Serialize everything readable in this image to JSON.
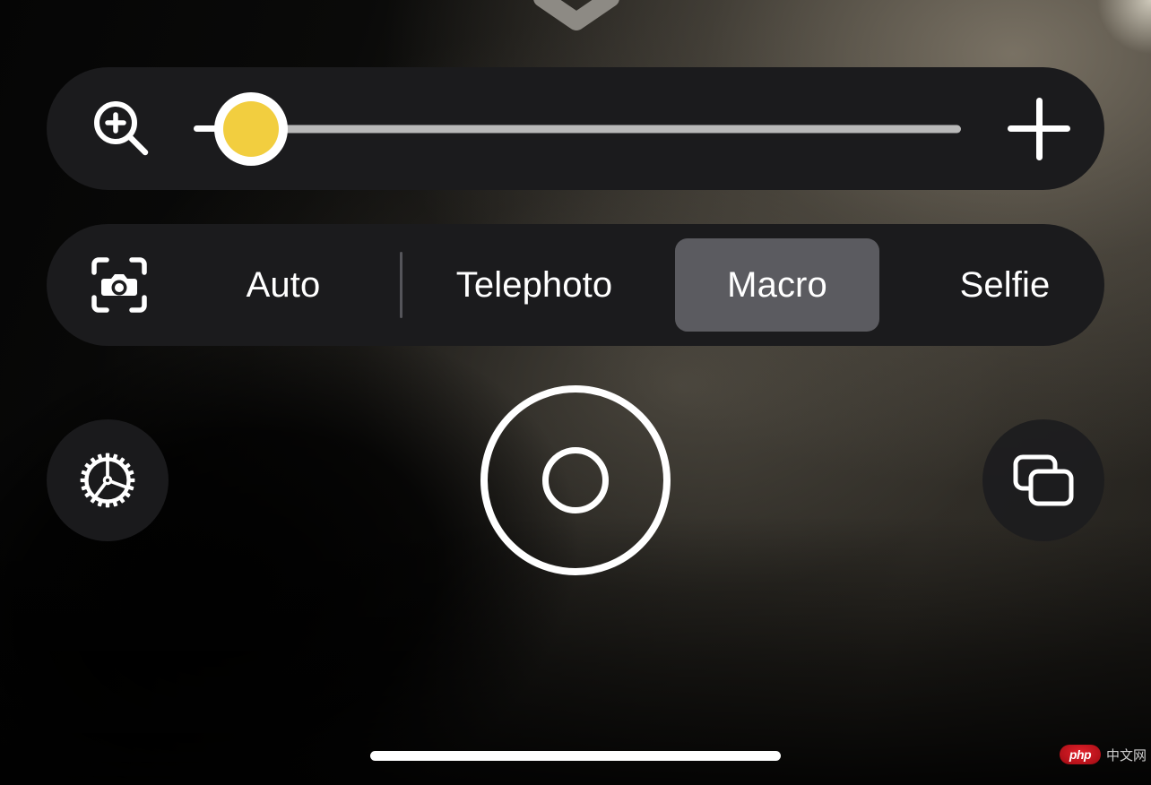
{
  "app": {
    "name": "Camera",
    "screen": "camera-viewfinder"
  },
  "handle": {
    "icon": "chevron-down-icon",
    "label": "Collapse controls"
  },
  "zoom_bar": {
    "icon": "magnifier-plus-icon",
    "zoom_out_label": "−",
    "zoom_out_name": "zoom-out-button",
    "zoom_in_label": "+",
    "zoom_in_name": "zoom-in-button",
    "slider": {
      "name": "zoom-slider",
      "value": 0,
      "min": 0,
      "max": 100,
      "thumb_color": "#f2ce3f",
      "thumb_ring_color": "#ffffff",
      "track_color": "#b9b9b9"
    }
  },
  "mode_bar": {
    "icon": "camera-frame-icon",
    "selected": "Macro",
    "items": [
      {
        "label": "Auto",
        "name": "mode-item-auto",
        "selected": false
      },
      {
        "label": "Telephoto",
        "name": "mode-item-telephoto",
        "selected": false
      },
      {
        "label": "Macro",
        "name": "mode-item-macro",
        "selected": true
      },
      {
        "label": "Selfie",
        "name": "mode-item-selfie",
        "selected": false
      }
    ],
    "selected_pill_color": "#5b5b60"
  },
  "controls": {
    "settings": {
      "icon": "gear-icon",
      "label": "Settings"
    },
    "shutter": {
      "icon": "shutter-icon",
      "label": "Capture"
    },
    "gallery": {
      "icon": "layers-icon",
      "label": "Gallery"
    }
  },
  "system": {
    "home_indicator": true
  },
  "watermark": {
    "logo_text": "php",
    "text": "中文网",
    "logo_color": "#c8121c"
  },
  "theme": {
    "panel_bg": "#1b1b1d",
    "accent": "#f2ce3f",
    "text": "#ffffff"
  }
}
